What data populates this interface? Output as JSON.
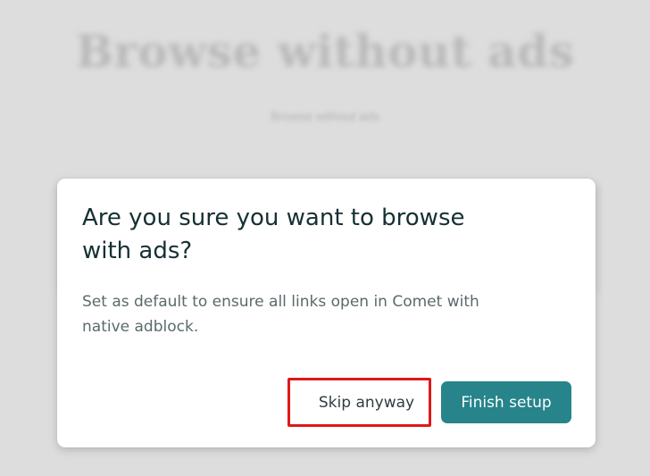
{
  "background": {
    "title": "Browse without ads",
    "subtitle": "Browse without ads"
  },
  "dialog": {
    "title": "Are you sure you want to browse with ads?",
    "message": "Set as default to ensure all links open in Comet with native adblock.",
    "skip_label": "Skip anyway",
    "finish_label": "Finish setup"
  },
  "colors": {
    "accent": "#26848a",
    "highlight_border": "#e01818",
    "title_text": "#163033",
    "body_text": "#5b6a6b",
    "backdrop": "#dddddd"
  }
}
